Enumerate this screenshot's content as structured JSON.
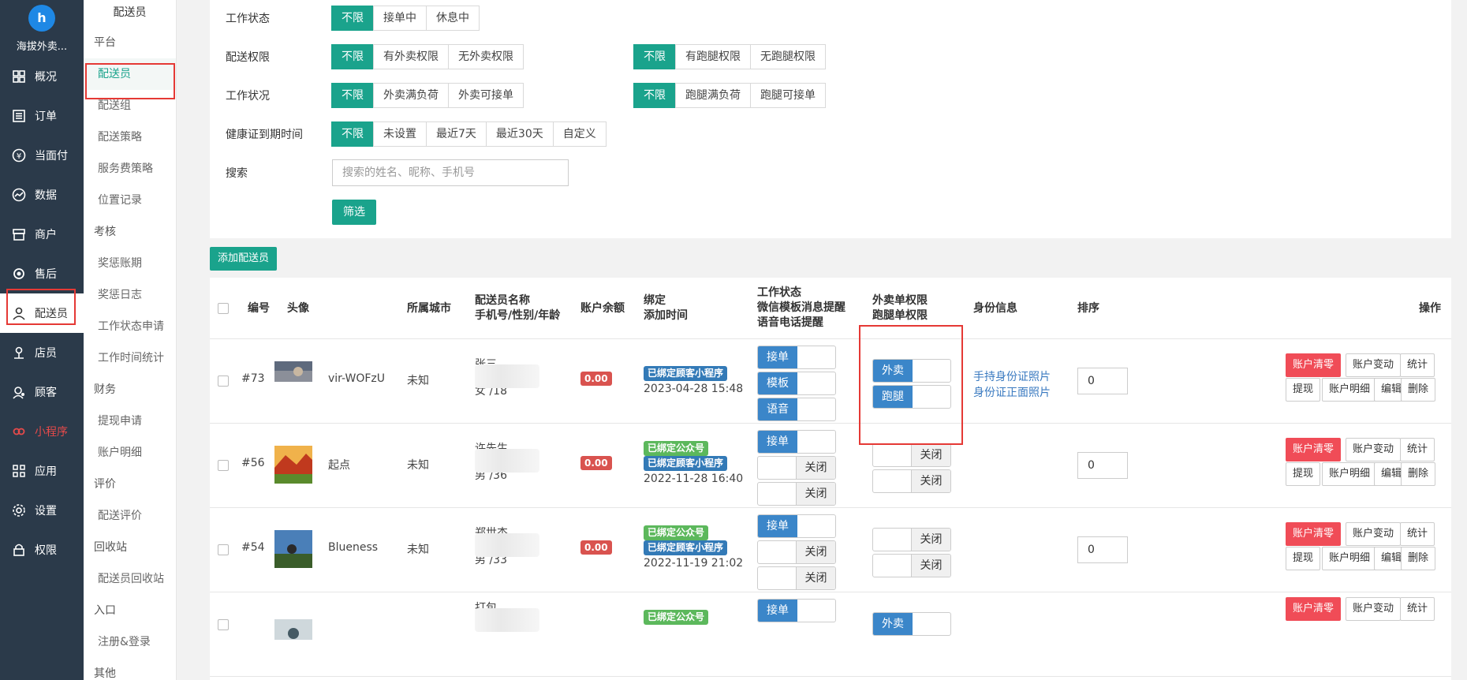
{
  "app": {
    "name": "海拔外卖..."
  },
  "nav": [
    {
      "label": "概况",
      "icon": "dashboard-icon"
    },
    {
      "label": "订单",
      "icon": "list-icon"
    },
    {
      "label": "当面付",
      "icon": "yen-icon"
    },
    {
      "label": "数据",
      "icon": "chart-icon"
    },
    {
      "label": "商户",
      "icon": "store-icon"
    },
    {
      "label": "售后",
      "icon": "headset-icon"
    },
    {
      "label": "配送员",
      "icon": "user-icon"
    },
    {
      "label": "店员",
      "icon": "person-icon"
    },
    {
      "label": "顾客",
      "icon": "customer-icon"
    },
    {
      "label": "小程序",
      "icon": "miniprogram-icon"
    },
    {
      "label": "应用",
      "icon": "apps-icon"
    },
    {
      "label": "设置",
      "icon": "gear-icon"
    },
    {
      "label": "权限",
      "icon": "lock-icon"
    }
  ],
  "subnav": {
    "title": "配送员",
    "groups": [
      {
        "label": "平台",
        "items": [
          "配送员",
          "配送组",
          "配送策略",
          "服务费策略",
          "位置记录"
        ]
      },
      {
        "label": "考核",
        "items": [
          "奖惩账期",
          "奖惩日志",
          "工作状态申请",
          "工作时间统计"
        ]
      },
      {
        "label": "财务",
        "items": [
          "提现申请",
          "账户明细"
        ]
      },
      {
        "label": "评价",
        "items": [
          "配送评价"
        ]
      },
      {
        "label": "回收站",
        "items": [
          "配送员回收站"
        ]
      },
      {
        "label": "入口",
        "items": [
          "注册&登录"
        ]
      },
      {
        "label": "其他",
        "items": []
      }
    ]
  },
  "filters": {
    "work_status": {
      "label": "工作状态",
      "options": [
        "不限",
        "接单中",
        "休息中"
      ]
    },
    "delivery_perm": {
      "label": "配送权限",
      "options": [
        "不限",
        "有外卖权限",
        "无外卖权限"
      ],
      "options2": [
        "不限",
        "有跑腿权限",
        "无跑腿权限"
      ]
    },
    "work_cond": {
      "label": "工作状况",
      "options": [
        "不限",
        "外卖满负荷",
        "外卖可接单"
      ],
      "options2": [
        "不限",
        "跑腿满负荷",
        "跑腿可接单"
      ]
    },
    "health": {
      "label": "健康证到期时间",
      "options": [
        "不限",
        "未设置",
        "最近7天",
        "最近30天",
        "自定义"
      ]
    },
    "search": {
      "label": "搜索",
      "placeholder": "搜索的姓名、昵称、手机号"
    },
    "submit": "筛选"
  },
  "add_button": "添加配送员",
  "columns": {
    "id": "编号",
    "avatar": "头像",
    "city": "所属城市",
    "name1": "配送员名称",
    "name2": "手机号/性别/年龄",
    "balance": "账户余额",
    "bind1": "绑定",
    "bind2": "添加时间",
    "work1": "工作状态",
    "work2": "微信模板消息提醒",
    "work3": "语音电话提醒",
    "perm1": "外卖单权限",
    "perm2": "跑腿单权限",
    "idinfo": "身份信息",
    "sort": "排序",
    "ops": "操作"
  },
  "rows": [
    {
      "id": "#73",
      "nick": "vir-WOFzU",
      "city": "未知",
      "name": "张三",
      "gender_age": "女 /18",
      "balance": "0.00",
      "tags": [
        {
          "text": "已绑定顾客小程序",
          "color": "blue"
        }
      ],
      "time": "2023-04-28 15:48",
      "work": [
        "接单",
        "模板",
        "语音"
      ],
      "perm": [
        "外卖",
        "跑腿"
      ],
      "idlinks": [
        "手持身份证照片",
        "身份证正面照片"
      ],
      "sort": "0"
    },
    {
      "id": "#56",
      "nick": "起点",
      "city": "未知",
      "name": "许先生",
      "gender_age": "男 /36",
      "balance": "0.00",
      "tags": [
        {
          "text": "已绑定公众号",
          "color": "green"
        },
        {
          "text": "已绑定顾客小程序",
          "color": "blue"
        }
      ],
      "time": "2022-11-28 16:40",
      "work": [
        "接单",
        "关闭",
        "关闭"
      ],
      "perm": [
        "关闭",
        "关闭"
      ],
      "idlinks": [],
      "sort": "0"
    },
    {
      "id": "#54",
      "nick": "Blueness",
      "city": "未知",
      "name": "郑世杰",
      "gender_age": "男 /33",
      "balance": "0.00",
      "tags": [
        {
          "text": "已绑定公众号",
          "color": "green"
        },
        {
          "text": "已绑定顾客小程序",
          "color": "blue"
        }
      ],
      "time": "2022-11-19 21:02",
      "work": [
        "接单",
        "关闭",
        "关闭"
      ],
      "perm": [
        "关闭",
        "关闭"
      ],
      "idlinks": [],
      "sort": "0"
    },
    {
      "id": "",
      "nick": "",
      "city": "",
      "name": "打包",
      "gender_age": "",
      "balance": "",
      "tags": [
        {
          "text": "已绑定公众号",
          "color": "green"
        }
      ],
      "time": "",
      "work": [
        "接单"
      ],
      "perm": [
        "外卖"
      ],
      "idlinks": [],
      "sort": ""
    }
  ],
  "ops": [
    "账户清零",
    "账户变动",
    "统计",
    "提现",
    "账户明细",
    "编辑",
    "删除"
  ]
}
